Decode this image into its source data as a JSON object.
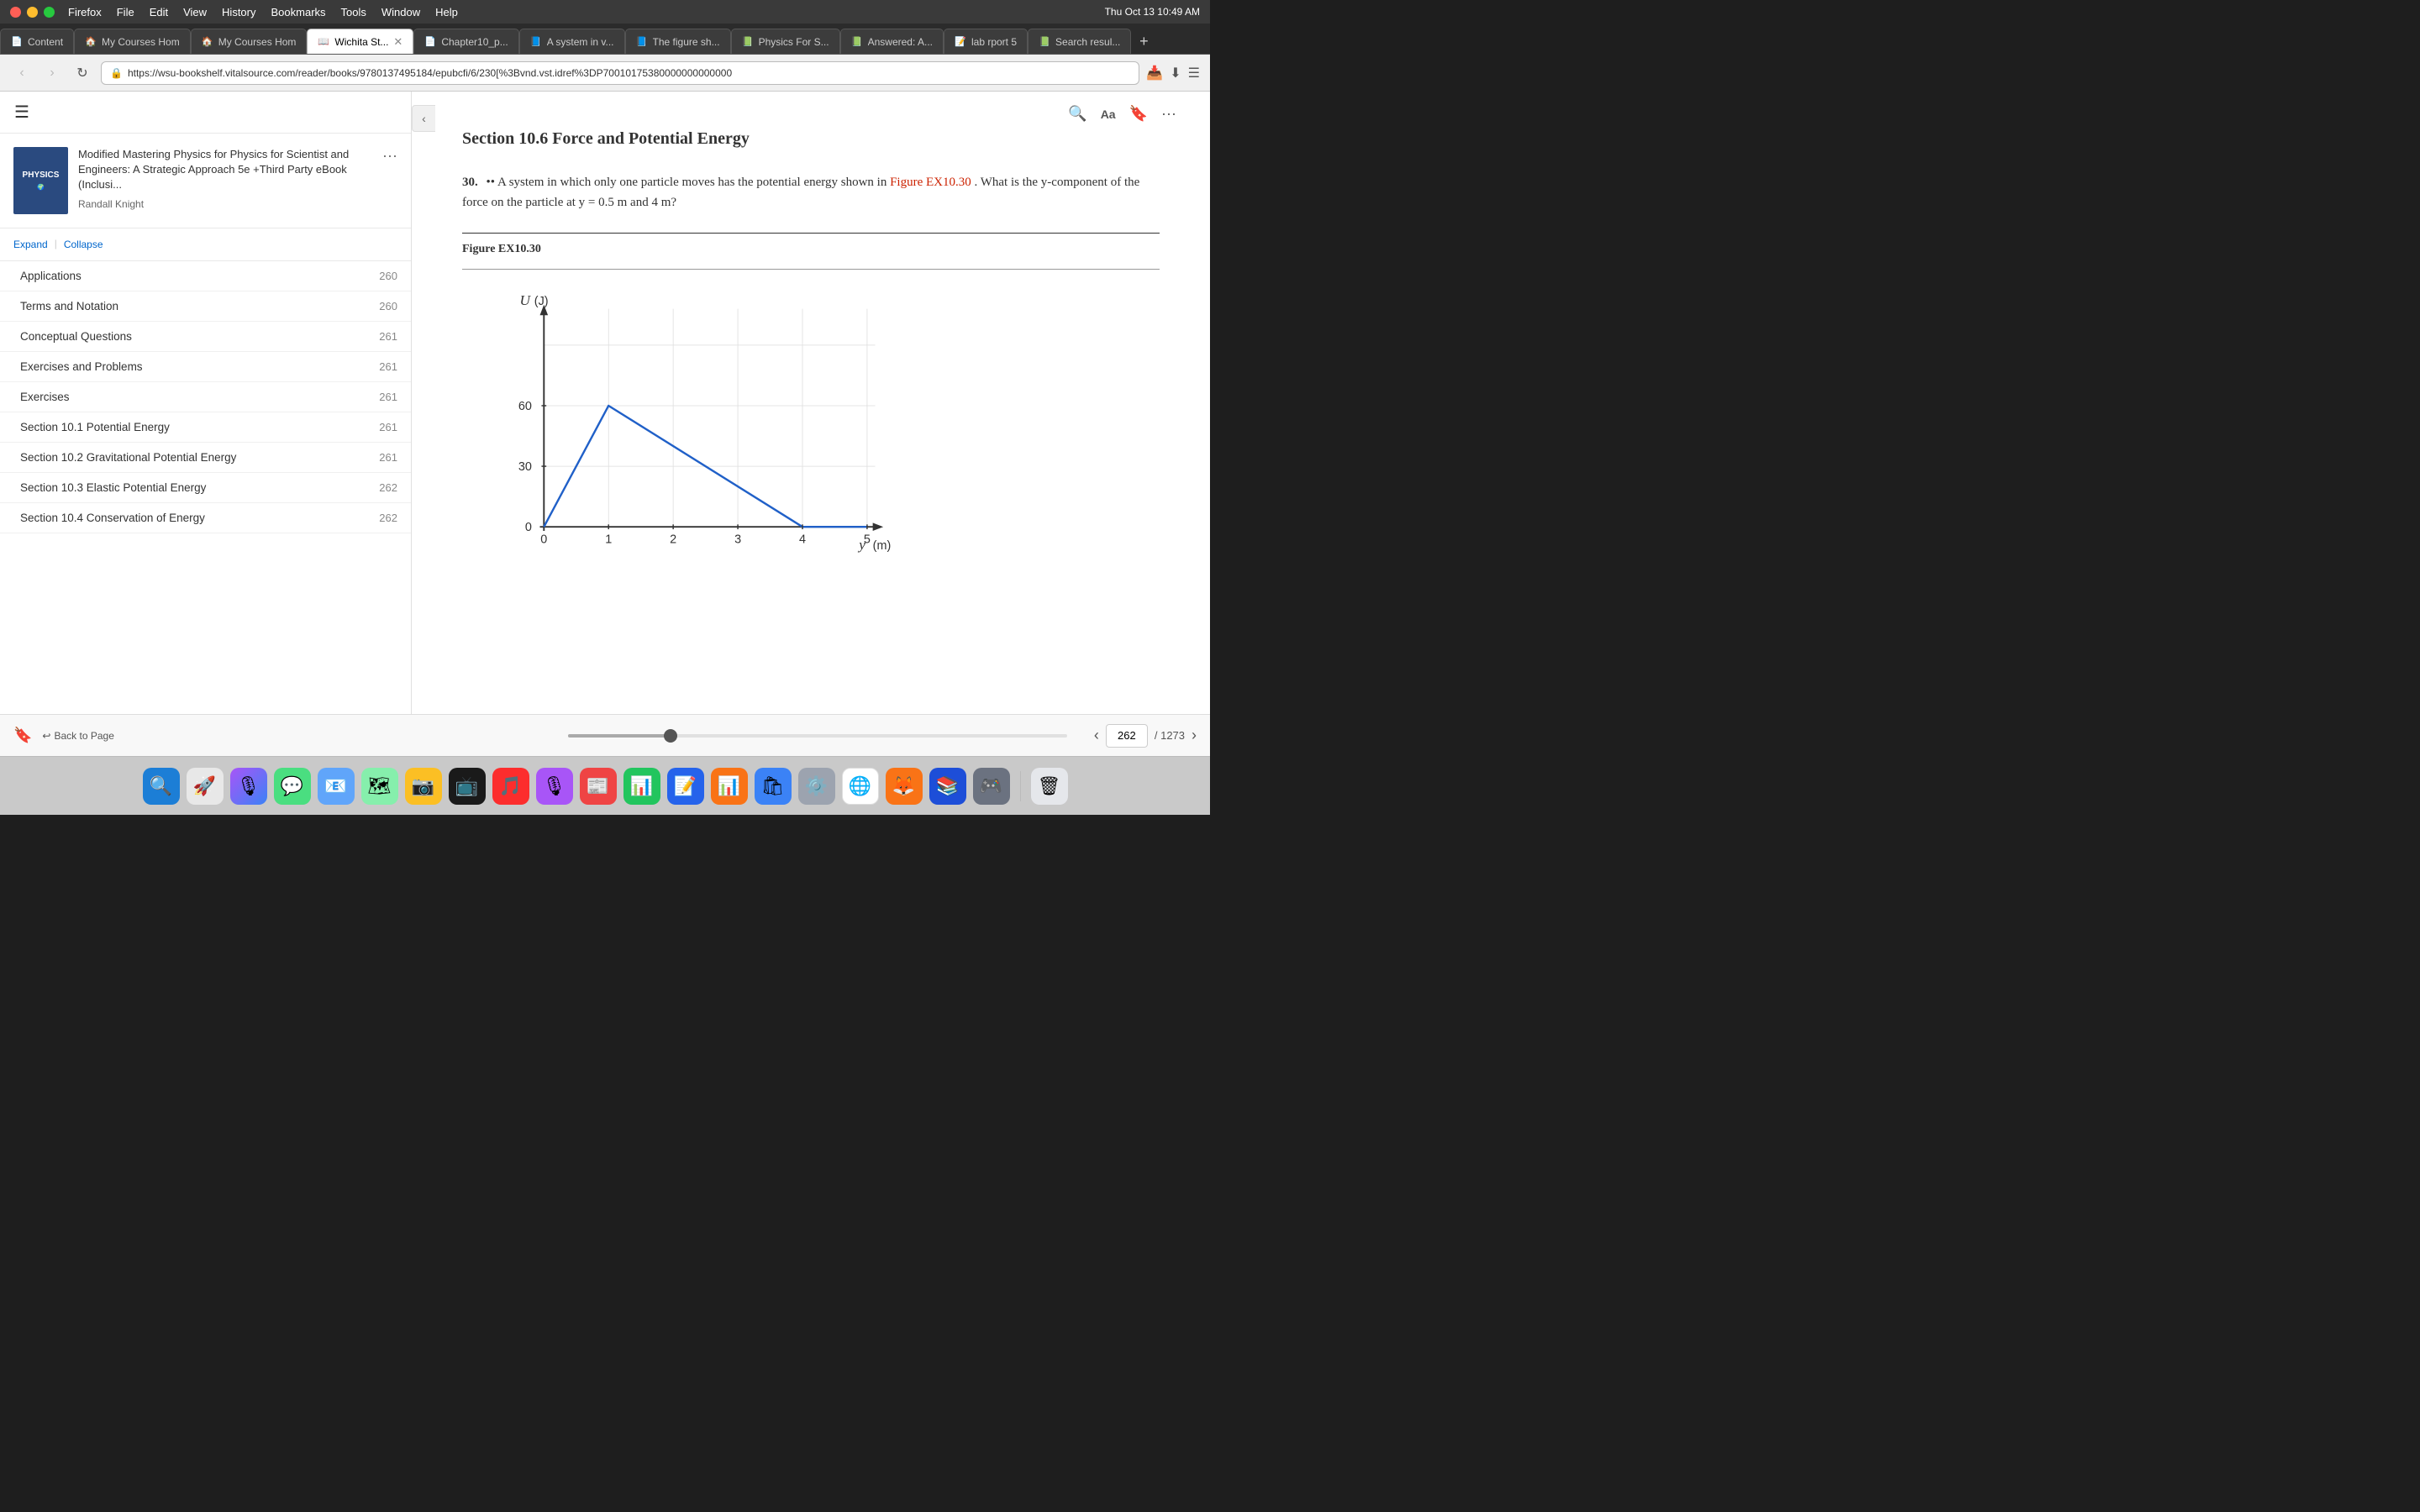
{
  "titleBar": {
    "appName": "Firefox",
    "menus": [
      "Firefox",
      "File",
      "Edit",
      "View",
      "History",
      "Bookmarks",
      "Tools",
      "Window",
      "Help"
    ],
    "time": "Thu Oct 13  10:49 AM"
  },
  "tabs": [
    {
      "id": "tab1",
      "favicon": "📄",
      "label": "Content",
      "active": false,
      "closable": false
    },
    {
      "id": "tab2",
      "favicon": "🏠",
      "label": "My Courses Hom",
      "active": false,
      "closable": false
    },
    {
      "id": "tab3",
      "favicon": "🏠",
      "label": "My Courses Hom",
      "active": false,
      "closable": false
    },
    {
      "id": "tab4",
      "favicon": "📖",
      "label": "Wichita St...",
      "active": true,
      "closable": true
    },
    {
      "id": "tab5",
      "favicon": "📄",
      "label": "Chapter10_p...",
      "active": false,
      "closable": false
    },
    {
      "id": "tab6",
      "favicon": "📘",
      "label": "A system in v...",
      "active": false,
      "closable": false
    },
    {
      "id": "tab7",
      "favicon": "📘",
      "label": "The figure sh...",
      "active": false,
      "closable": false
    },
    {
      "id": "tab8",
      "favicon": "📗",
      "label": "Physics For S...",
      "active": false,
      "closable": false
    },
    {
      "id": "tab9",
      "favicon": "📗",
      "label": "Answered: A...",
      "active": false,
      "closable": false
    },
    {
      "id": "tab10",
      "favicon": "📝",
      "label": "lab rport 5",
      "active": false,
      "closable": false
    },
    {
      "id": "tab11",
      "favicon": "📗",
      "label": "Search resul...",
      "active": false,
      "closable": false
    }
  ],
  "navBar": {
    "url": "https://wsu-bookshelf.vitalsource.com/reader/books/9780137495184/epubcfi/6/230[%3Bvnd.vst.idref%3DP70010175380000000000000",
    "backEnabled": false,
    "forwardEnabled": false
  },
  "sidebar": {
    "bookCoverText": "PHYSICS",
    "bookTitle": "Modified Mastering Physics for Physics for Scientist and Engineers: A Strategic Approach 5e +Third Party eBook (Inclusi...",
    "bookAuthor": "Randall Knight",
    "expandLabel": "Expand",
    "collapseLabel": "Collapse",
    "navItems": [
      {
        "label": "Applications",
        "page": "260"
      },
      {
        "label": "Terms and Notation",
        "page": "260"
      },
      {
        "label": "Conceptual Questions",
        "page": "261"
      },
      {
        "label": "Exercises and Problems",
        "page": "261"
      },
      {
        "label": "Exercises",
        "page": "261"
      },
      {
        "label": "Section 10.1 Potential Energy",
        "page": "261"
      },
      {
        "label": "Section 10.2 Gravitational Potential Energy",
        "page": "261"
      },
      {
        "label": "Section 10.3 Elastic Potential Energy",
        "page": "262"
      },
      {
        "label": "Section 10.4 Conservation of Energy",
        "page": "262"
      }
    ]
  },
  "reader": {
    "sectionTitle": "Section 10.6 Force and Potential Energy",
    "problemNumber": "30.",
    "problemDots": "••",
    "problemText": "A system in which only one particle moves has the potential energy shown in",
    "figureLink": "Figure EX10.30",
    "problemTextEnd": ". What is the y-component of the force on the particle at y = 0.5 m and 4 m?",
    "figureLabel": "Figure EX10.30",
    "chart": {
      "xAxisLabel": "y (m)",
      "yAxisLabel": "U (J)",
      "yValues": [
        0,
        30,
        60
      ],
      "xValues": [
        0,
        1,
        2,
        3,
        4,
        5
      ],
      "points": [
        {
          "x": 0,
          "y": 0
        },
        {
          "x": 1,
          "y": 60
        },
        {
          "x": 4,
          "y": 0
        },
        {
          "x": 5,
          "y": 0
        }
      ]
    }
  },
  "bottomBar": {
    "currentPage": "262",
    "totalPages": "/ 1273",
    "progressPercent": 20.5,
    "backToPageLabel": "Back to Page"
  },
  "dock": {
    "icons": [
      "🔍",
      "📁",
      "📧",
      "💬",
      "📷",
      "🎵",
      "🎬",
      "🎙",
      "🔧",
      "🌐",
      "🦊",
      "🔥",
      "📚",
      "🎮",
      "⚙️",
      "🗑"
    ]
  }
}
